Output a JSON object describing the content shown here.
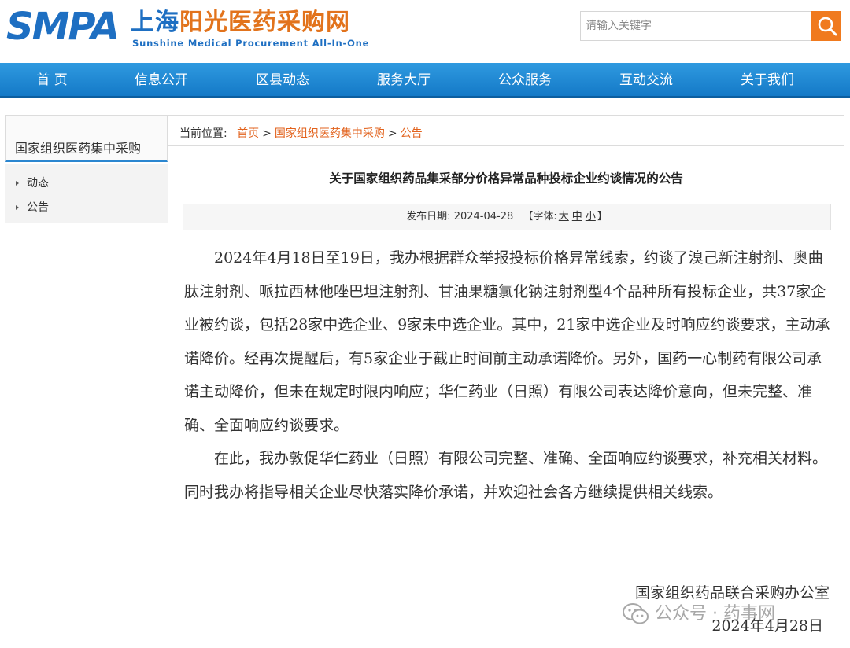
{
  "header": {
    "logo_abbr": "SMPA",
    "logo_name_part1": "上海",
    "logo_name_part2": "阳光医药采购网",
    "logo_subtitle": "Sunshine Medical Procurement All-In-One",
    "search_placeholder": "请输入关键字",
    "search_icon": "magnifier-icon"
  },
  "nav": {
    "items": [
      "首 页",
      "信息公开",
      "区县动态",
      "服务大厅",
      "公众服务",
      "互动交流",
      "关于我们"
    ]
  },
  "sidebar": {
    "title": "国家组织医药集中采购",
    "items": [
      "动态",
      "公告"
    ]
  },
  "breadcrumb": {
    "prefix": "当前位置:",
    "items": [
      "首页",
      "国家组织医药集中采购",
      "公告"
    ],
    "separator": ">"
  },
  "article": {
    "title": "关于国家组织药品集采部分价格异常品种投标企业约谈情况的公告",
    "date_label": "发布日期:",
    "date": "2024-04-28",
    "font_label_open": "【字体:",
    "font_large": "大",
    "font_medium": "中",
    "font_small": "小",
    "font_label_close": "】",
    "paragraphs": [
      "2024年4月18日至19日，我办根据群众举报投标价格异常线索，约谈了溴己新注射剂、奥曲肽注射剂、哌拉西林他唑巴坦注射剂、甘油果糖氯化钠注射剂型4个品种所有投标企业，共37家企业被约谈，包括28家中选企业、9家未中选企业。其中，21家中选企业及时响应约谈要求，主动承诺降价。经再次提醒后，有5家企业于截止时间前主动承诺降价。另外，国药一心制药有限公司承诺主动降价，但未在规定时限内响应；华仁药业（日照）有限公司表达降价意向，但未完整、准确、全面响应约谈要求。",
      "在此，我办敦促华仁药业（日照）有限公司完整、准确、全面响应约谈要求，补充相关材料。同时我办将指导相关企业尽快落实降价承诺，并欢迎社会各方继续提供相关线索。"
    ],
    "signature_org": "国家组织药品联合采购办公室",
    "signature_date": "2024年4月28日"
  },
  "watermark": {
    "text": "公众号 · 药事网",
    "icon": "wechat-icon"
  }
}
